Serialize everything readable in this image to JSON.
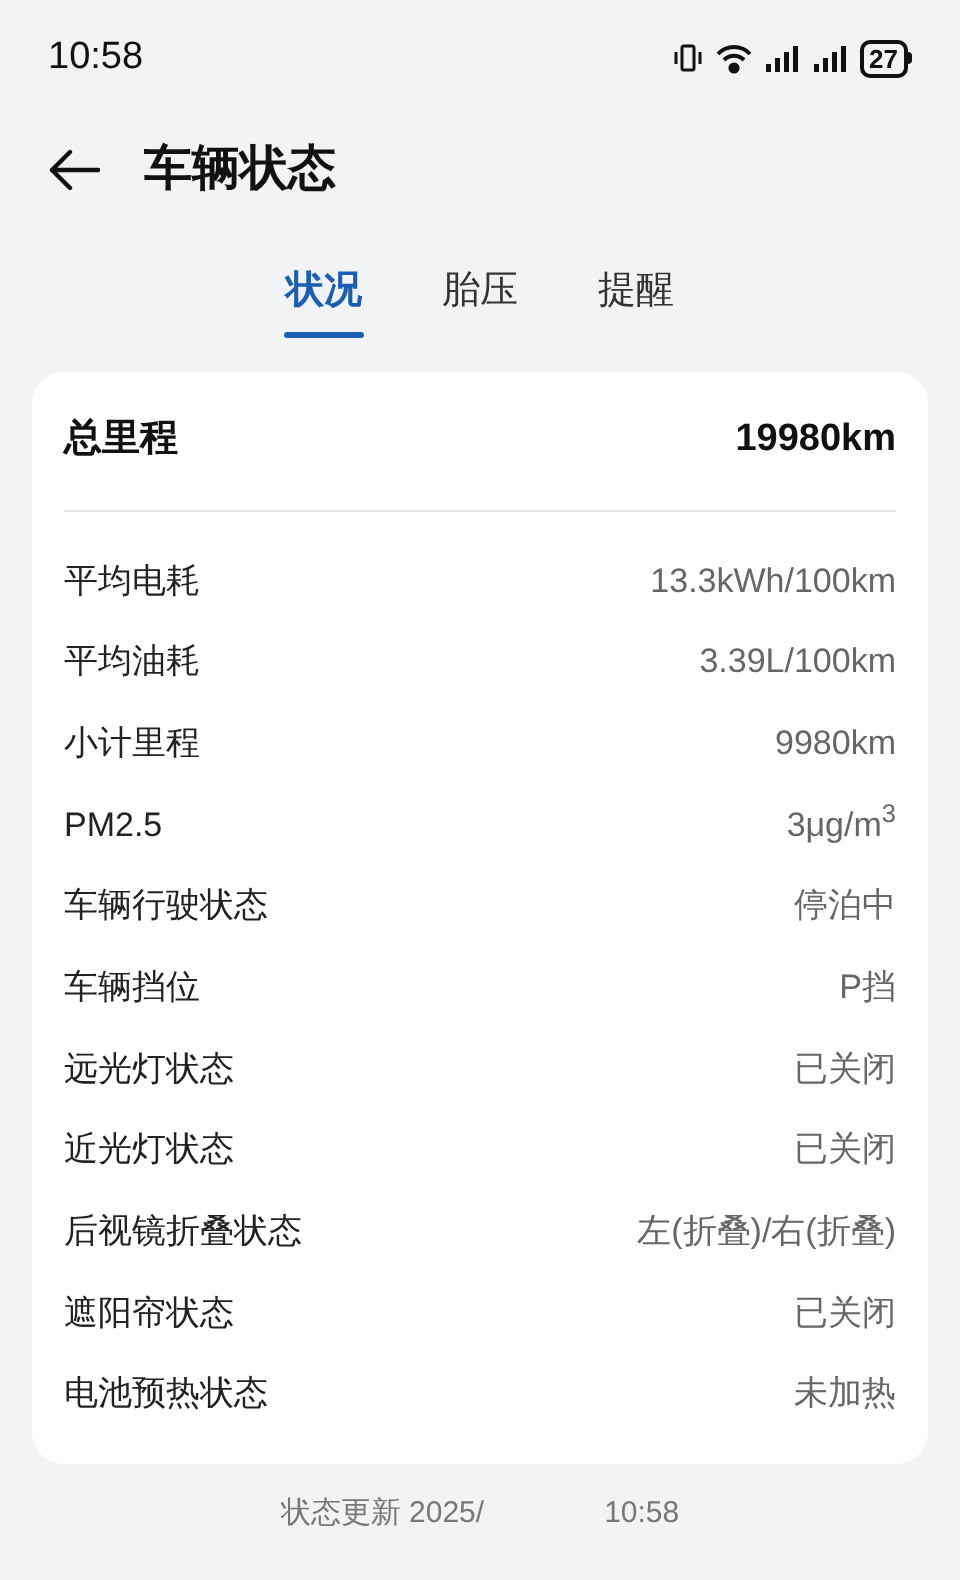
{
  "status_bar": {
    "time": "10:58",
    "battery": "27"
  },
  "header": {
    "title": "车辆状态"
  },
  "tabs": [
    {
      "label": "状况",
      "selected": true
    },
    {
      "label": "胎压",
      "selected": false
    },
    {
      "label": "提醒",
      "selected": false
    }
  ],
  "summary": {
    "label": "总里程",
    "value": "19980km"
  },
  "rows": [
    {
      "label": "平均电耗",
      "value": "13.3kWh/100km"
    },
    {
      "label": "平均油耗",
      "value": "3.39L/100km"
    },
    {
      "label": "小计里程",
      "value": "9980km"
    },
    {
      "label": "PM2.5",
      "value": "3μg/m$^{3}$"
    },
    {
      "label": "车辆行驶状态",
      "value": "停泊中"
    },
    {
      "label": "车辆挡位",
      "value": "P挡"
    },
    {
      "label": "远光灯状态",
      "value": "已关闭"
    },
    {
      "label": "近光灯状态",
      "value": "已关闭"
    },
    {
      "label": "后视镜折叠状态",
      "value": "左(折叠)/右(折叠)"
    },
    {
      "label": "遮阳帘状态",
      "value": "已关闭"
    },
    {
      "label": "电池预热状态",
      "value": "未加热"
    }
  ],
  "footer": {
    "update_parts": [
      "状态更新 2025/",
      "10:58"
    ]
  }
}
